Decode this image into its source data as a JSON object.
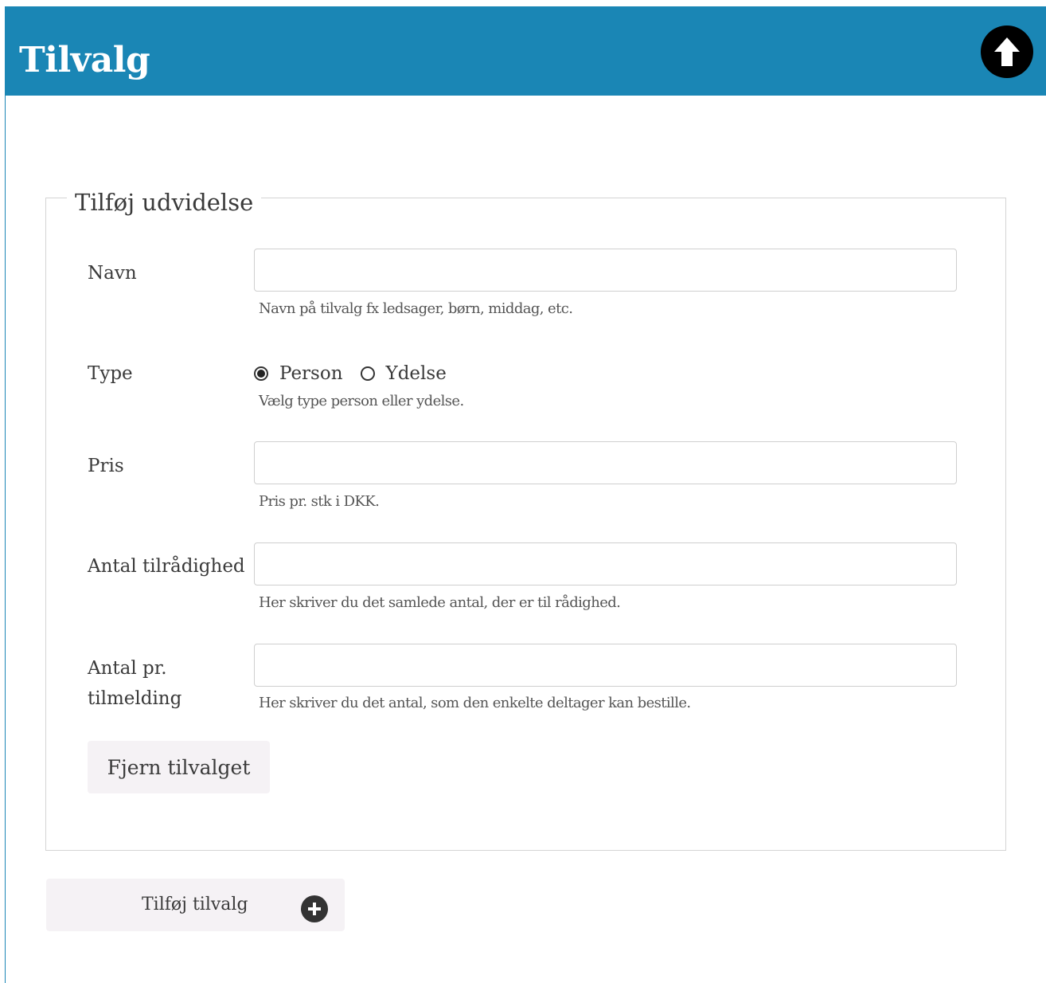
{
  "header": {
    "title": "Tilvalg",
    "collapse_icon": "arrow-up-circle-icon",
    "background_color": "#1a86b5"
  },
  "form": {
    "legend": "Tilføj udvidelse",
    "fields": {
      "name": {
        "label": "Navn",
        "value": "",
        "help": "Navn på tilvalg fx ledsager, børn, middag, etc."
      },
      "type": {
        "label": "Type",
        "options": [
          "Person",
          "Ydelse"
        ],
        "selected": "Person",
        "help": "Vælg type person eller ydelse."
      },
      "price": {
        "label": "Pris",
        "value": "",
        "help": "Pris pr. stk i DKK."
      },
      "available": {
        "label": "Antal tilrådighed",
        "value": "",
        "help": "Her skriver du det samlede antal, der er til rådighed."
      },
      "per_signup": {
        "label_line1": "Antal pr.",
        "label_line2": "tilmelding",
        "value": "",
        "help": "Her skriver du det antal, som den enkelte deltager kan bestille."
      }
    },
    "remove_button": "Fjern tilvalget"
  },
  "add_button": {
    "label": "Tilføj tilvalg",
    "icon": "plus-circle-icon"
  }
}
